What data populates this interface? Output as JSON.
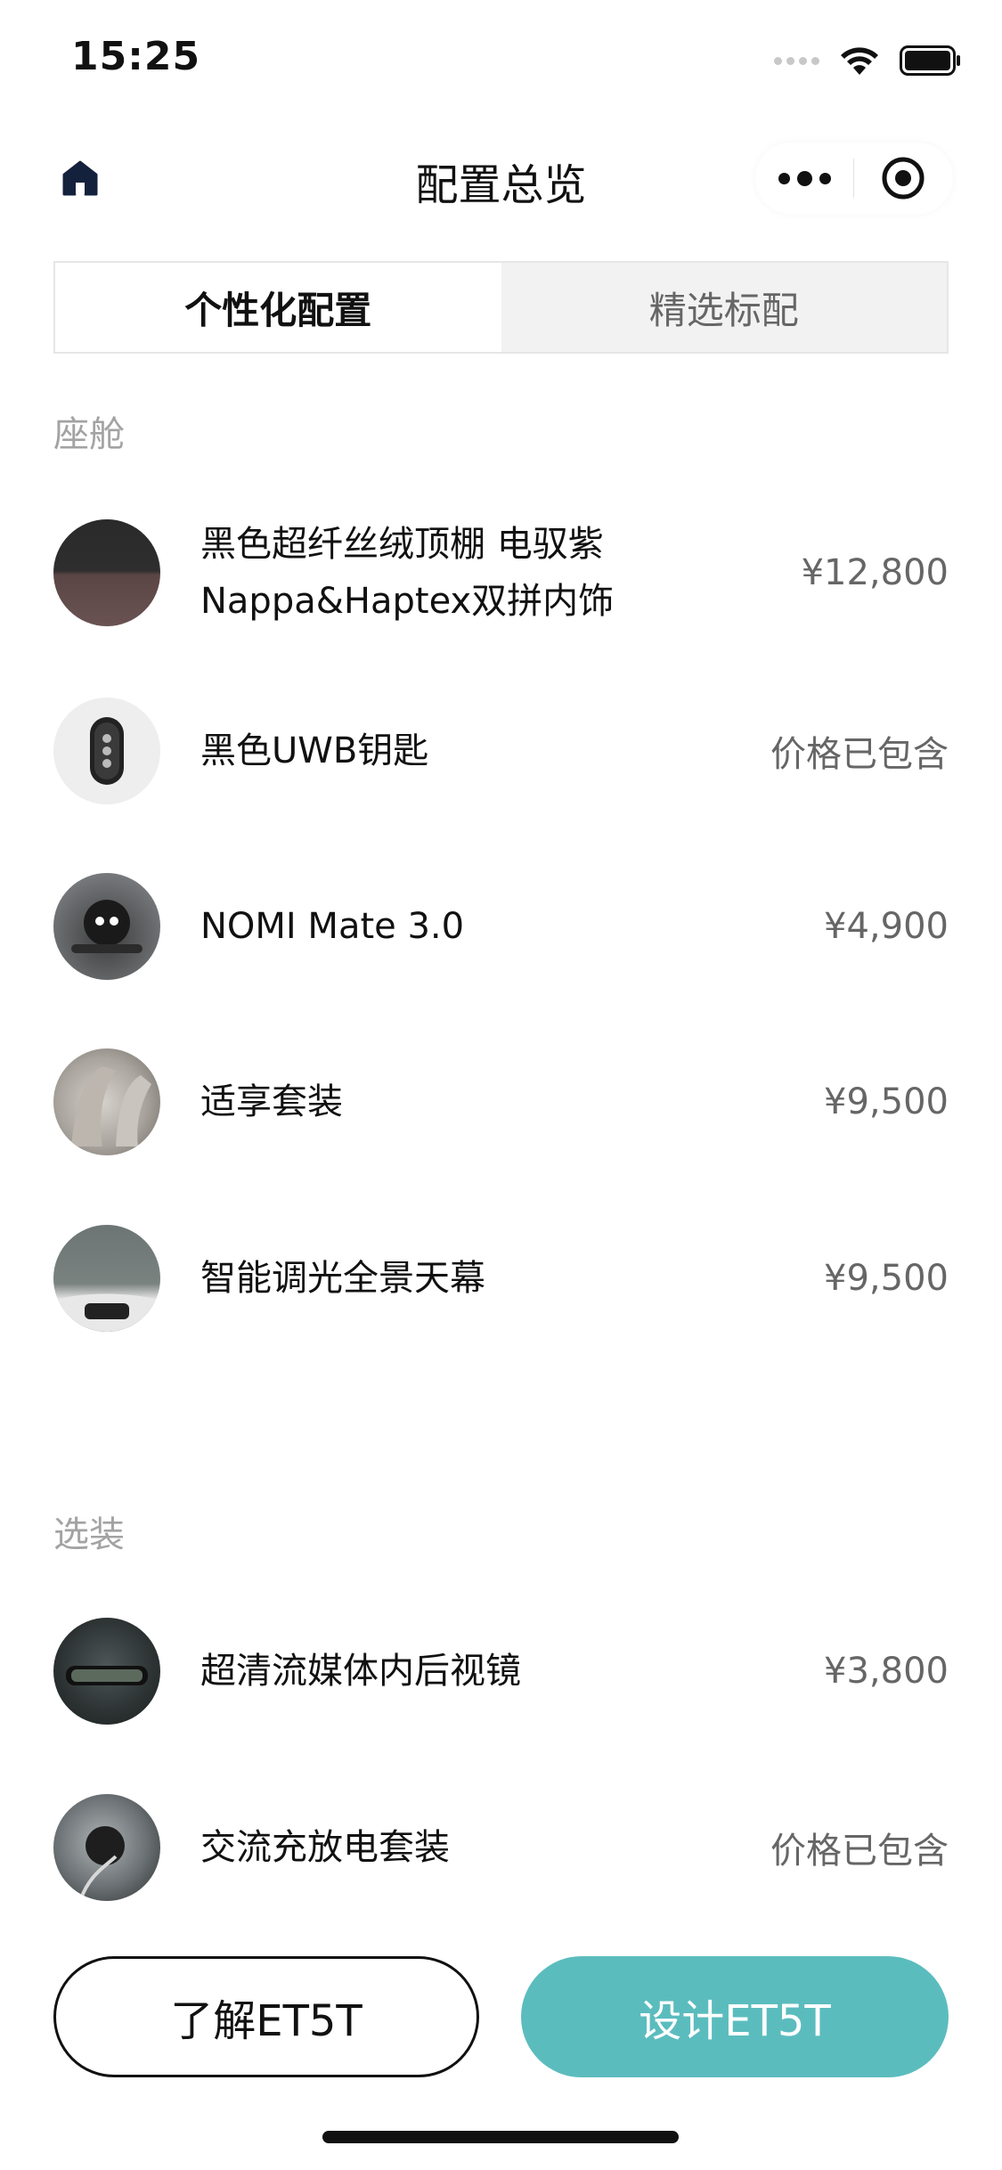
{
  "status_bar": {
    "time": "15:25"
  },
  "nav": {
    "title": "配置总览",
    "home_icon": "home-icon",
    "more_icon": "more-dots-icon",
    "target_icon": "target-icon"
  },
  "tabs": [
    {
      "label": "个性化配置",
      "active": true
    },
    {
      "label": "精选标配",
      "active": false
    }
  ],
  "sections": [
    {
      "label": "座舱",
      "items": [
        {
          "name": "黑色超纤丝绒顶棚 电驭紫\nNappa&Haptex双拼内饰",
          "price": "¥12,800"
        },
        {
          "name": "黑色UWB钥匙",
          "price": "价格已包含"
        },
        {
          "name": "NOMI Mate 3.0",
          "price": "¥4,900"
        },
        {
          "name": "适享套装",
          "price": "¥9,500"
        },
        {
          "name": "智能调光全景天幕",
          "price": "¥9,500"
        }
      ]
    },
    {
      "label": "选装",
      "items": [
        {
          "name": "超清流媒体内后视镜",
          "price": "¥3,800"
        },
        {
          "name": "交流充放电套装",
          "price": "价格已包含"
        }
      ]
    }
  ],
  "footer": {
    "learn_label": "了解ET5T",
    "design_label": "设计ET5T"
  },
  "colors": {
    "accent": "#5bbcbe",
    "text": "#111111",
    "muted": "#a3a3a3",
    "price": "#666666"
  }
}
